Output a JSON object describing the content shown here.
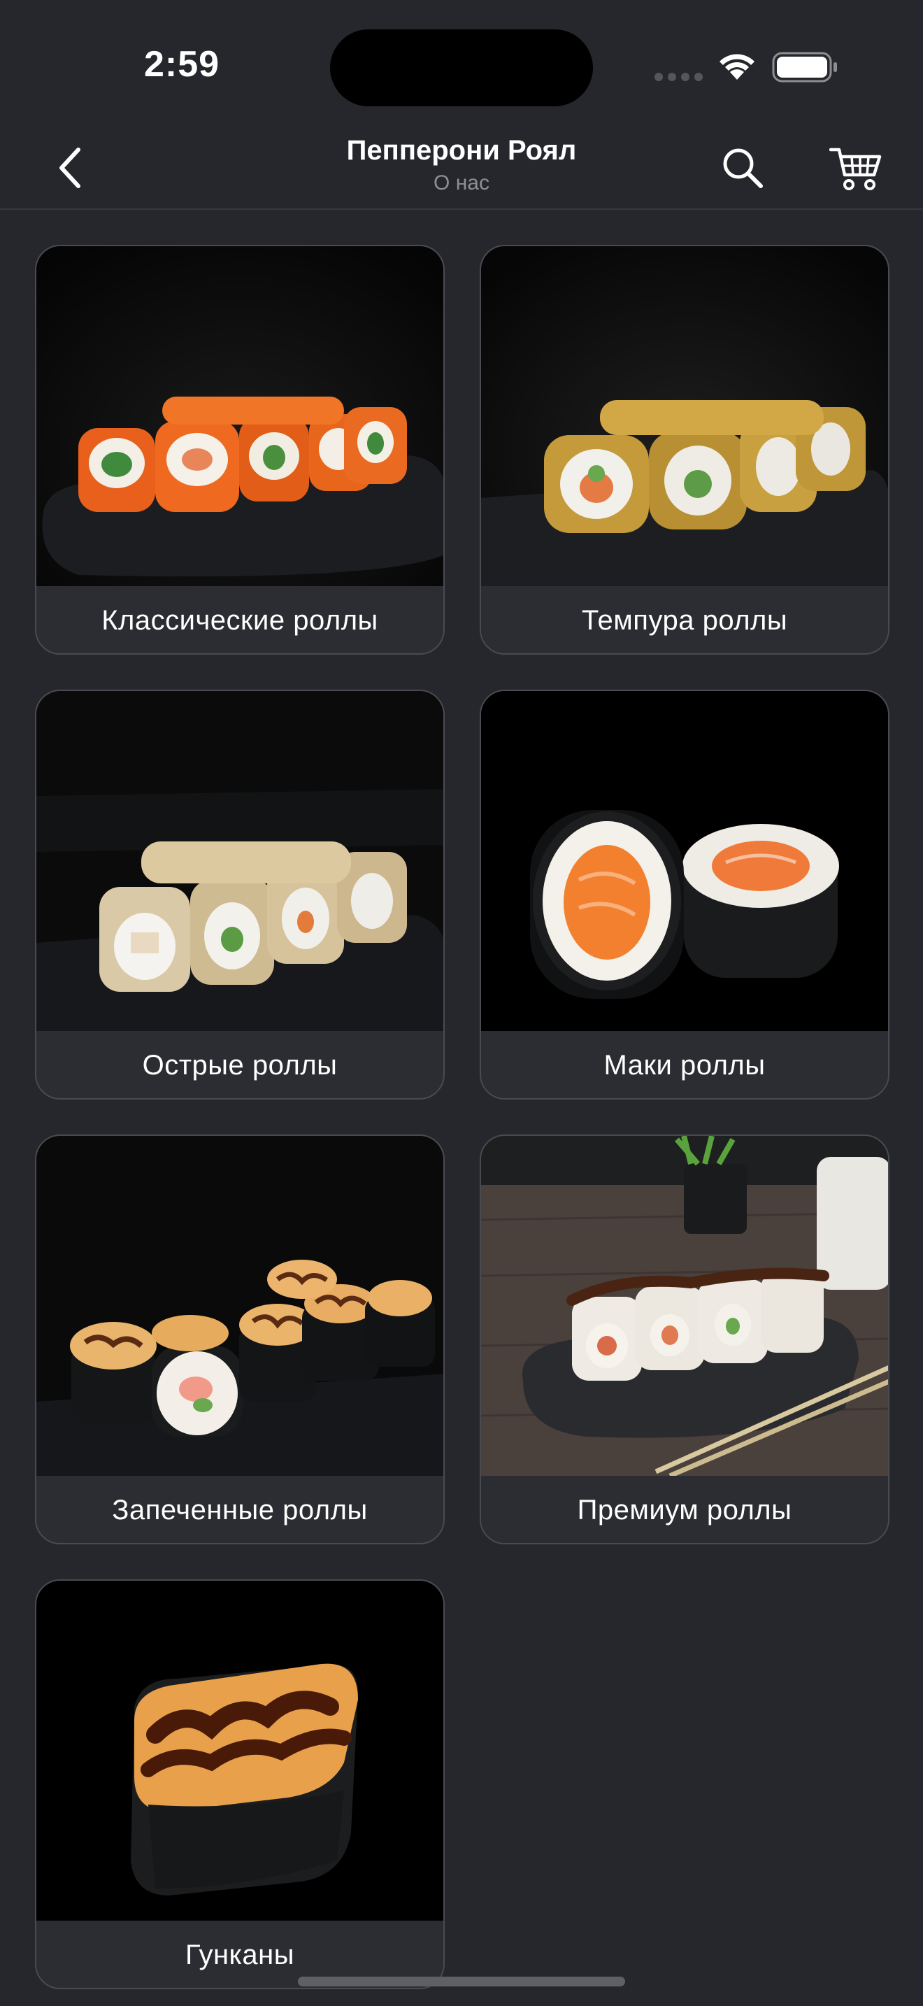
{
  "status_bar": {
    "time": "2:59"
  },
  "nav": {
    "title": "Пепперони Роял",
    "subtitle": "О нас",
    "icons": {
      "back": "chevron-left-icon",
      "search": "search-icon",
      "cart": "cart-icon"
    }
  },
  "categories": [
    {
      "label": "Классические роллы",
      "image": "classic-rolls-photo"
    },
    {
      "label": "Темпура роллы",
      "image": "tempura-rolls-photo"
    },
    {
      "label": "Острые роллы",
      "image": "spicy-rolls-photo"
    },
    {
      "label": "Маки роллы",
      "image": "maki-rolls-photo"
    },
    {
      "label": "Запеченные роллы",
      "image": "baked-rolls-photo"
    },
    {
      "label": "Премиум роллы",
      "image": "premium-rolls-photo"
    },
    {
      "label": "Гунканы",
      "image": "gunkan-photo"
    }
  ],
  "colors": {
    "background": "#26272c",
    "card_border": "#4a4b51",
    "subtitle": "#8d8e93"
  }
}
